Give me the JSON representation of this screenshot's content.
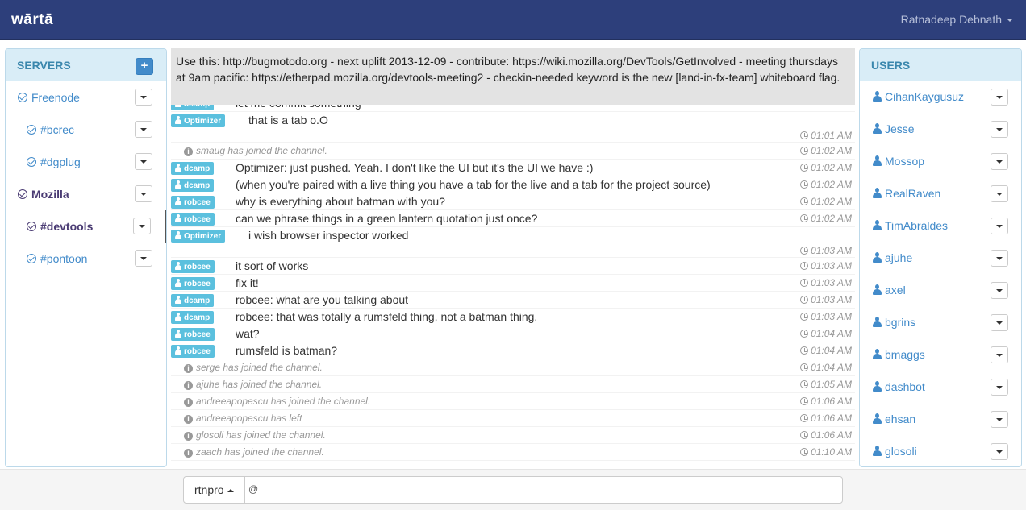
{
  "app": {
    "brand": "wārtā",
    "user": "Ratnadeep Debnath"
  },
  "servers": {
    "title": "SERVERS",
    "add_label": "+",
    "items": [
      {
        "label": "Freenode",
        "sub": false,
        "active": false
      },
      {
        "label": "#bcrec",
        "sub": true,
        "active": false
      },
      {
        "label": "#dgplug",
        "sub": true,
        "active": false
      },
      {
        "label": "Mozilla",
        "sub": false,
        "active": true
      },
      {
        "label": "#devtools",
        "sub": true,
        "active": true
      },
      {
        "label": "#pontoon",
        "sub": true,
        "active": false
      }
    ]
  },
  "topic": "Use this: http://bugmotodo.org - next uplift 2013-12-09 - contribute: https://wiki.mozilla.org/DevTools/GetInvolved - meeting thursdays at 9am pacific: https://etherpad.mozilla.org/devtools-meeting2 - checkin-needed keyword is the new [land-in-fx-team] whiteboard flag.",
  "messages": [
    {
      "type": "msg",
      "nick": "dcamp",
      "text": "let me commit something",
      "time": "",
      "partial": true
    },
    {
      "type": "msg",
      "nick": "Optimizer",
      "text": "that is a tab o.O",
      "time": "01:01 AM",
      "tall": true
    },
    {
      "type": "sys",
      "text": "smaug has joined the channel.",
      "time": "01:02 AM"
    },
    {
      "type": "msg",
      "nick": "dcamp",
      "text": "Optimizer: just pushed. Yeah. I don't like the UI but it's the UI we have :)",
      "time": "01:02 AM"
    },
    {
      "type": "msg",
      "nick": "dcamp",
      "text": "(when you're paired with a live thing you have a tab for the live and a tab for the project source)",
      "time": "01:02 AM"
    },
    {
      "type": "msg",
      "nick": "robcee",
      "text": "why is everything about batman with you?",
      "time": "01:02 AM"
    },
    {
      "type": "msg",
      "nick": "robcee",
      "text": "can we phrase things in a green lantern quotation just once?",
      "time": "01:02 AM"
    },
    {
      "type": "msg",
      "nick": "Optimizer",
      "text": "i wish browser inspector worked",
      "time": "01:03 AM",
      "tall": true
    },
    {
      "type": "msg",
      "nick": "robcee",
      "text": "it sort of works",
      "time": "01:03 AM"
    },
    {
      "type": "msg",
      "nick": "robcee",
      "text": "fix it!",
      "time": "01:03 AM"
    },
    {
      "type": "msg",
      "nick": "dcamp",
      "text": "robcee: what are you talking about",
      "time": "01:03 AM"
    },
    {
      "type": "msg",
      "nick": "dcamp",
      "text": "robcee: that was totally a rumsfeld thing, not a batman thing.",
      "time": "01:03 AM"
    },
    {
      "type": "msg",
      "nick": "robcee",
      "text": "wat?",
      "time": "01:04 AM"
    },
    {
      "type": "msg",
      "nick": "robcee",
      "text": "rumsfeld is batman?",
      "time": "01:04 AM"
    },
    {
      "type": "sys",
      "text": "serge has joined the channel.",
      "time": "01:04 AM"
    },
    {
      "type": "sys",
      "text": "ajuhe has joined the channel.",
      "time": "01:05 AM"
    },
    {
      "type": "sys",
      "text": "andreeapopescu has joined the channel.",
      "time": "01:06 AM"
    },
    {
      "type": "sys",
      "text": "andreeapopescu has left",
      "time": "01:06 AM"
    },
    {
      "type": "sys",
      "text": "glosoli has joined the channel.",
      "time": "01:06 AM"
    },
    {
      "type": "sys",
      "text": "zaach has joined the channel.",
      "time": "01:10 AM"
    }
  ],
  "users": {
    "title": "USERS",
    "items": [
      "CihanKaygusuz",
      "Jesse",
      "Mossop",
      "RealRaven",
      "TimAbraldes",
      "ajuhe",
      "axel",
      "bgrins",
      "bmaggs",
      "dashbot",
      "ehsan",
      "glosoli"
    ]
  },
  "composer": {
    "nick": "rtnpro",
    "value": "@"
  },
  "colors": {
    "navbar": "#2d3f7b",
    "nick_badge": "#5bc0de",
    "link": "#428bca",
    "panel_head": "#d9edf7"
  }
}
